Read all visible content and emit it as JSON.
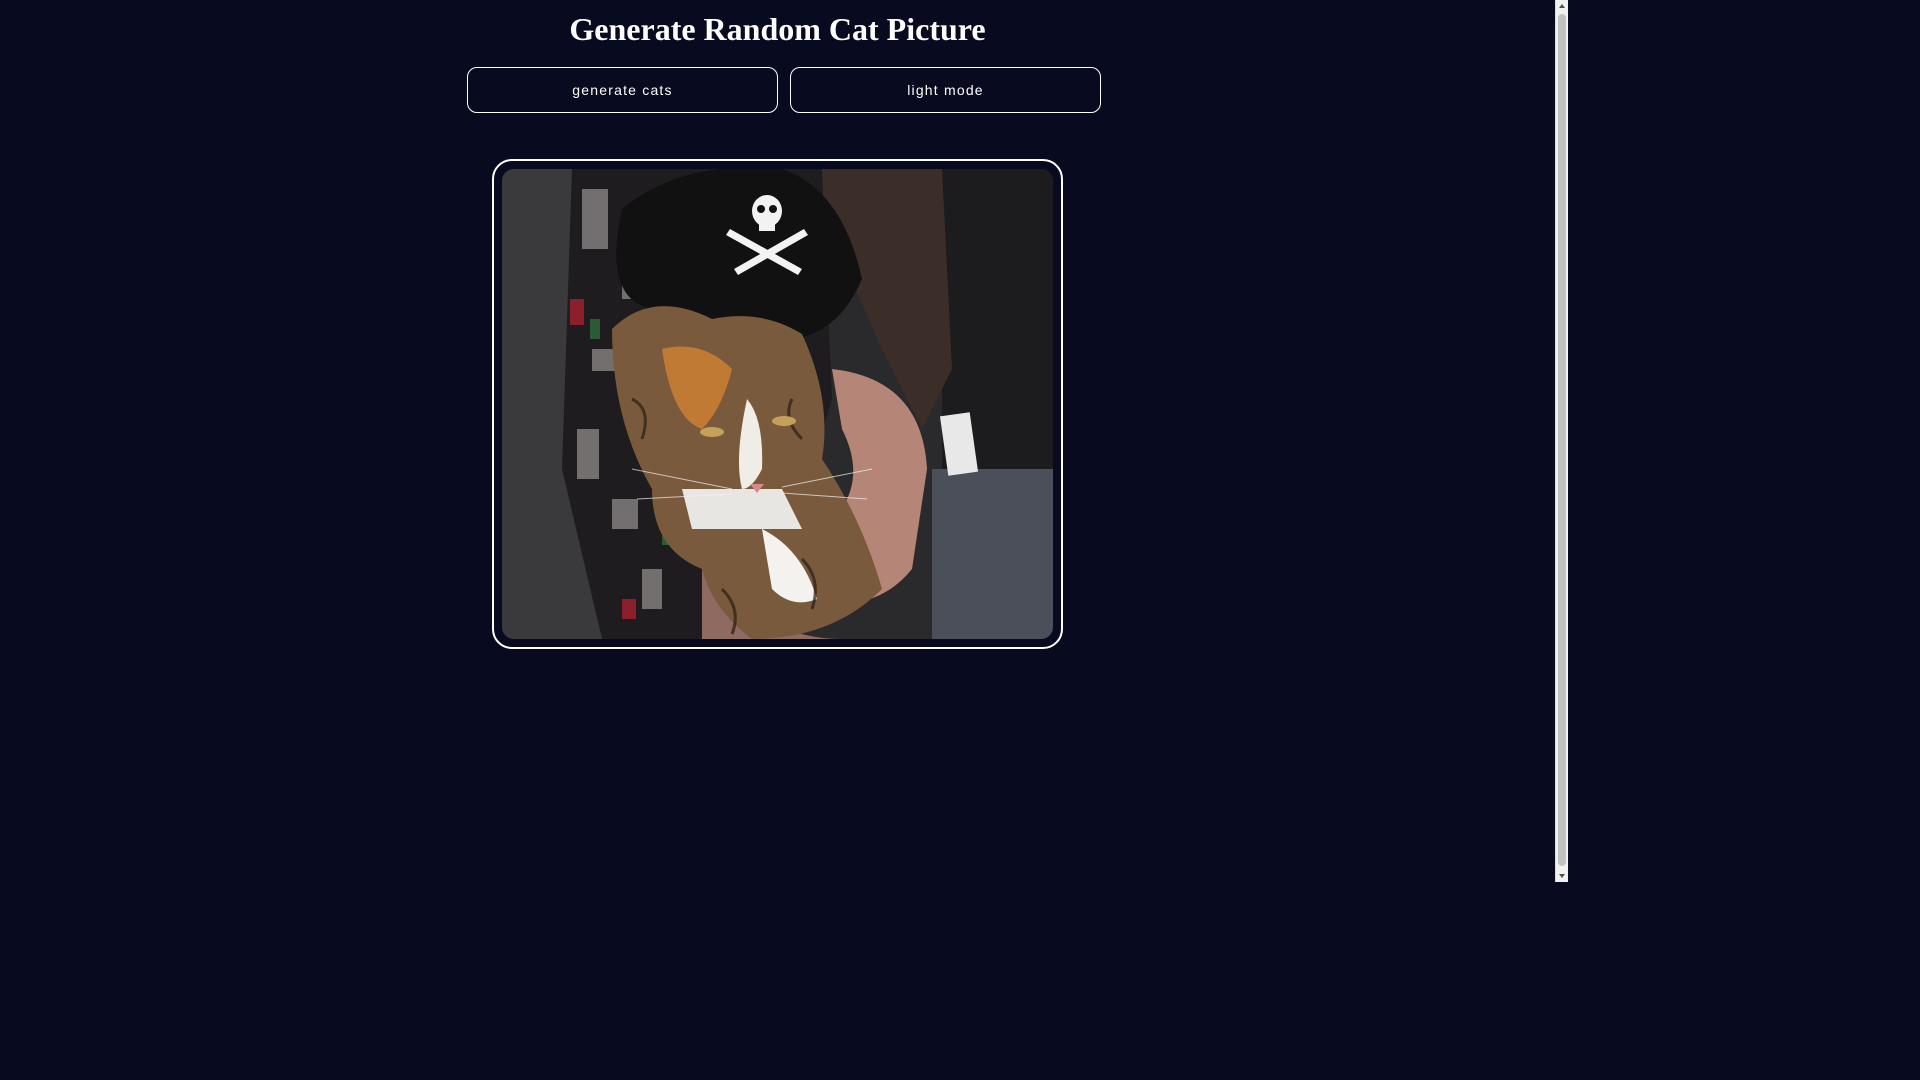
{
  "page": {
    "title": "Generate Random Cat Picture"
  },
  "controls": {
    "generate_label": "generate cats",
    "theme_label": "light mode"
  },
  "cat_image": {
    "alt": "random cat picture"
  },
  "colors": {
    "background": "#080b20",
    "foreground": "#ffffff",
    "scrollbar_track": "#f1f1f1",
    "scrollbar_thumb": "#c1c1c1"
  }
}
